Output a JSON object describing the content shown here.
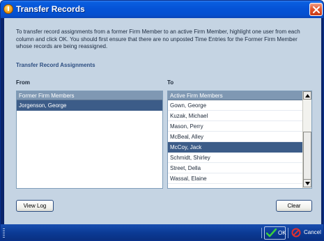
{
  "window": {
    "title": "Transfer Records"
  },
  "intro_text": "To transfer record assignments from a former Firm Member to an active Firm Member, highlight one user from each column and click OK. You should first ensure that there are no unposted Time Entries for the Former Firm Member whose records are being reassigned.",
  "section_title": "Transfer Record Assignments",
  "from_panel": {
    "label": "From",
    "header": "Former Firm Members",
    "items": [
      {
        "name": "Jorgenson, George",
        "selected": true
      }
    ]
  },
  "to_panel": {
    "label": "To",
    "header": "Active Firm Members",
    "items": [
      {
        "name": "Gown, George",
        "selected": false
      },
      {
        "name": "Kuzak, Michael",
        "selected": false
      },
      {
        "name": "Mason, Perry",
        "selected": false
      },
      {
        "name": "McBeal, Alley",
        "selected": false
      },
      {
        "name": "McCoy, Jack",
        "selected": true
      },
      {
        "name": "Schmidt, Shirley",
        "selected": false
      },
      {
        "name": "Street, Della",
        "selected": false
      },
      {
        "name": "Wassal, Elaine",
        "selected": false
      }
    ]
  },
  "buttons": {
    "view_log": "View Log",
    "clear": "Clear",
    "ok": "OK",
    "cancel": "Cancel"
  },
  "icons": {
    "app": "app-info-icon",
    "close": "close-icon",
    "ok": "checkmark-icon",
    "cancel": "no-entry-icon",
    "scroll_up": "scroll-up-arrow-icon",
    "scroll_down": "scroll-down-arrow-icon"
  },
  "colors": {
    "title_bar": "#0553d6",
    "dialog_background": "#c5d4e3",
    "selection": "#3c5c88",
    "list_header": "#7f98b3",
    "section_title": "#2c4d80",
    "status_bar": "#0b3a94"
  }
}
